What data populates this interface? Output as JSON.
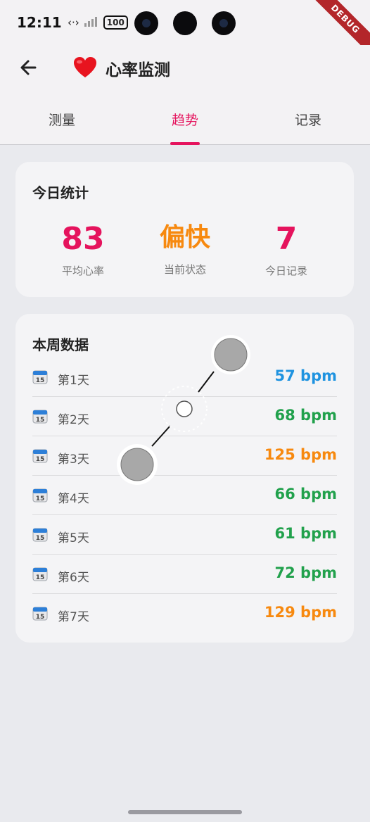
{
  "status_bar": {
    "time": "12:11",
    "network_icon": "data-transfer-icon",
    "signal_icon": "signal-icon",
    "battery": "100"
  },
  "debug_banner": "DEBUG",
  "app_bar": {
    "title": "心率监测",
    "back_icon": "back-arrow-icon",
    "heart_icon": "heart-icon"
  },
  "tabs": [
    {
      "label": "测量",
      "active": false
    },
    {
      "label": "趋势",
      "active": true
    },
    {
      "label": "记录",
      "active": false
    }
  ],
  "today_stats": {
    "title": "今日统计",
    "items": [
      {
        "value": "83",
        "label": "平均心率",
        "color": "#e5135d"
      },
      {
        "value": "偏快",
        "label": "当前状态",
        "color": "#f7890f"
      },
      {
        "value": "7",
        "label": "今日记录",
        "color": "#e5135d"
      }
    ]
  },
  "weekly_data": {
    "title": "本周数据",
    "rows": [
      {
        "label": "第1天",
        "value": "57 bpm",
        "color": "#1f93e0"
      },
      {
        "label": "第2天",
        "value": "68 bpm",
        "color": "#21a14c"
      },
      {
        "label": "第3天",
        "value": "125 bpm",
        "color": "#f7890f"
      },
      {
        "label": "第4天",
        "value": "66 bpm",
        "color": "#21a14c"
      },
      {
        "label": "第5天",
        "value": "61 bpm",
        "color": "#21a14c"
      },
      {
        "label": "第6天",
        "value": "72 bpm",
        "color": "#21a14c"
      },
      {
        "label": "第7天",
        "value": "129 bpm",
        "color": "#f7890f"
      }
    ]
  },
  "colors": {
    "accent": "#e5135d",
    "background": "#e9eaee",
    "card": "#f4f4f6"
  }
}
